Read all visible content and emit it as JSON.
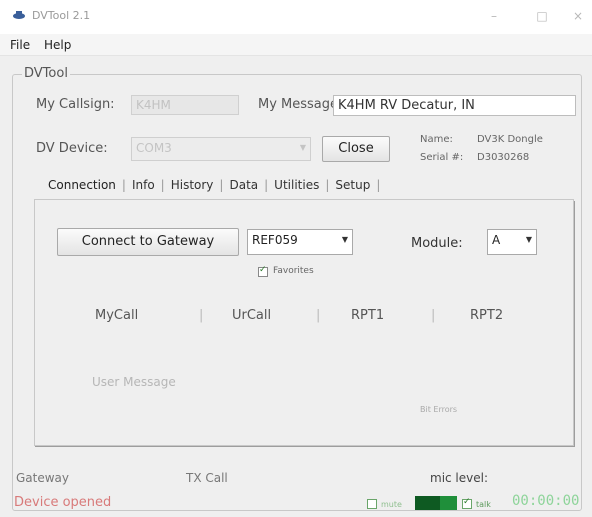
{
  "window": {
    "title": "DVTool 2.1",
    "icon": "dvtool-app-icon",
    "controls": {
      "minimize": "–",
      "maximize": "□",
      "close": "×"
    }
  },
  "menu": {
    "file": "File",
    "help": "Help"
  },
  "group_title": "DVTool",
  "callsign": {
    "label": "My Callsign:",
    "value": "K4HM"
  },
  "message": {
    "label": "My Message:",
    "value": "K4HM RV Decatur, IN"
  },
  "device": {
    "label": "DV Device:",
    "selected": "COM3",
    "close_label": "Close",
    "name_label": "Name:",
    "name_value": "DV3K Dongle",
    "serial_label": "Serial #:",
    "serial_value": "D3030268"
  },
  "tabs": [
    "Connection",
    "Info",
    "History",
    "Data",
    "Utilities",
    "Setup"
  ],
  "connection": {
    "connect_label": "Connect to Gateway",
    "reflector": "REF059",
    "favorites_label": "Favorites",
    "favorites_checked": true,
    "module_label": "Module:",
    "module_value": "A",
    "columns": [
      "MyCall",
      "UrCall",
      "RPT1",
      "RPT2"
    ],
    "column_separator": "|",
    "user_message_placeholder": "User Message",
    "bit_errors_label": "Bit Errors"
  },
  "status": {
    "gateway_label": "Gateway",
    "tx_call_label": "TX Call",
    "mic_level_label": "mic level:",
    "device_status": "Device opened",
    "device_status_color": "#d87a7a",
    "mute_label": "mute",
    "mute_checked": false,
    "talk_label": "talk",
    "talk_checked": true,
    "mic_level_fraction": 0.6,
    "timer": "00:00:00"
  }
}
